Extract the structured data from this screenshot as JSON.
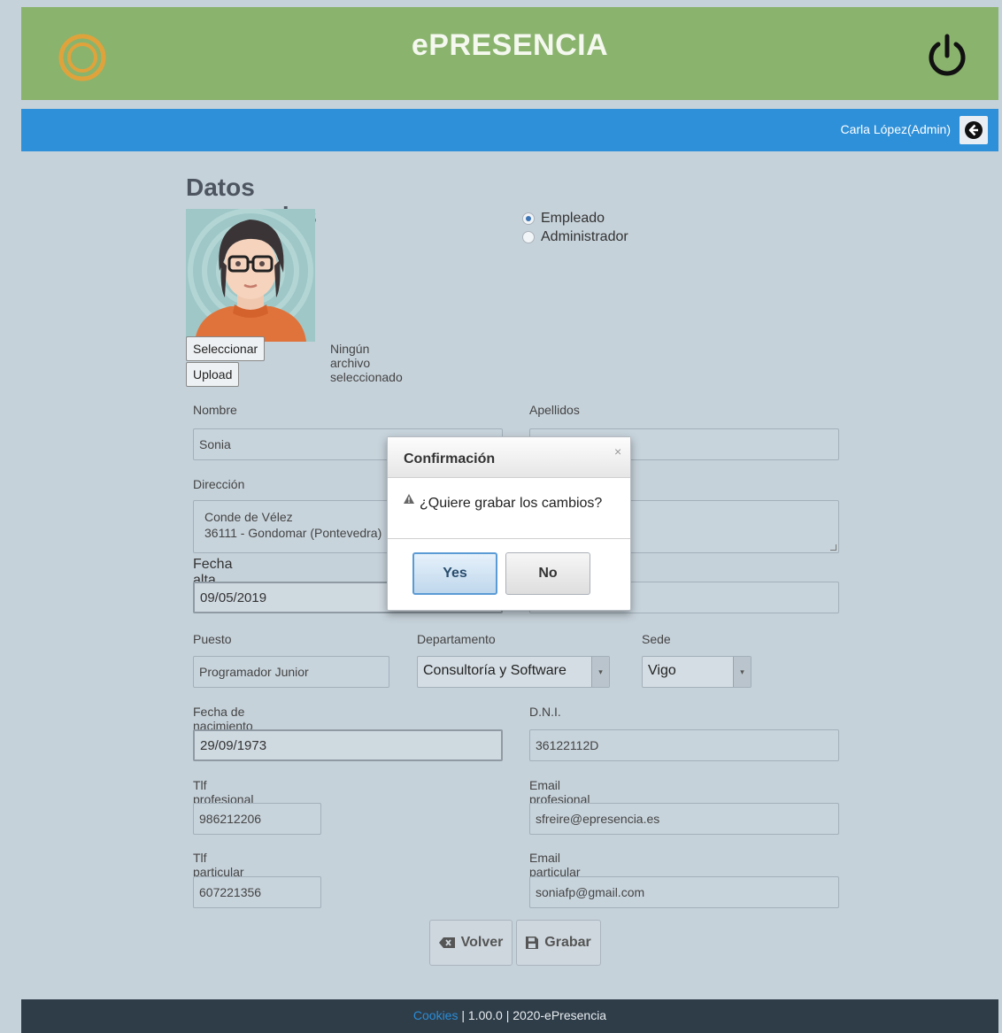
{
  "header": {
    "app_title": "ePRESENCIA",
    "brand_color": "#8ab36d",
    "user_label": "Carla López(Admin)",
    "userbar_color": "#2d90d9"
  },
  "page": {
    "title": "Datos personales",
    "role_options": [
      "Empleado",
      "Administrador"
    ],
    "selected_role": "Empleado",
    "file_button": "Seleccionar archivo",
    "file_status": "Ningún archivo seleccionado",
    "upload_button": "Upload"
  },
  "form": {
    "nombre": {
      "label": "Nombre",
      "value": "Sonia"
    },
    "apellidos": {
      "label": "Apellidos",
      "value": ""
    },
    "direccion": {
      "label": "Dirección",
      "line1": "Conde de Vélez",
      "line2": "36111 - Gondomar (Pontevedra)"
    },
    "fecha_alta": {
      "label": "Fecha alta empresa",
      "value": "09/05/2019"
    },
    "puesto": {
      "label": "Puesto",
      "value": "Programador Junior"
    },
    "departamento": {
      "label": "Departamento",
      "value": "Consultoría y Software"
    },
    "sede": {
      "label": "Sede",
      "value": "Vigo"
    },
    "fecha_nacimiento": {
      "label": "Fecha de nacimiento",
      "value": "29/09/1973"
    },
    "dni": {
      "label": "D.N.I.",
      "value": "36122112D"
    },
    "tlf_profesional": {
      "label": "Tlf profesional",
      "value": "986212206"
    },
    "email_profesional": {
      "label": "Email profesional",
      "value": "sfreire@epresencia.es"
    },
    "tlf_particular": {
      "label": "Tlf particular",
      "value": "607221356"
    },
    "email_particular": {
      "label": "Email particular",
      "value": "soniafp@gmail.com"
    }
  },
  "actions": {
    "back": "Volver",
    "save": "Grabar"
  },
  "dialog": {
    "title": "Confirmación",
    "close": "×",
    "message": "¿Quiere grabar los cambios?",
    "yes": "Yes",
    "no": "No"
  },
  "footer": {
    "cookies": "Cookies",
    "rest": " | 1.00.0 | 2020-ePresencia"
  },
  "icons": [
    "logo-icon",
    "power-icon",
    "back-arrow-icon",
    "warning-icon",
    "backspace-icon",
    "save-icon"
  ]
}
